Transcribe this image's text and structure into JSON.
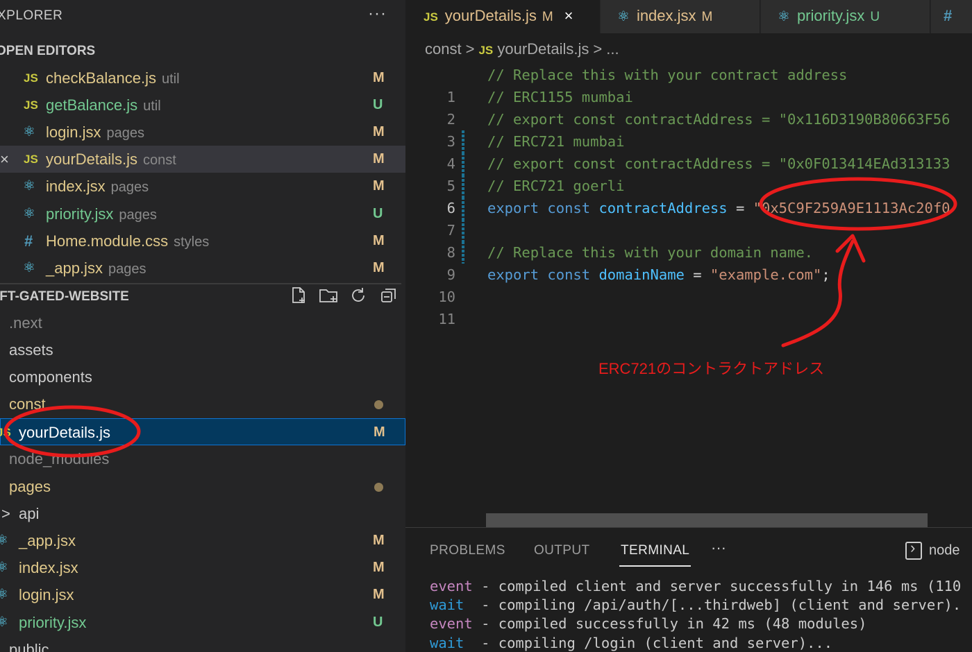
{
  "sidebar": {
    "title": "XPLORER",
    "more": "···",
    "open_editors_title": "OPEN EDITORS",
    "open_editors": [
      {
        "icon": "JS",
        "name": "checkBalance.js",
        "desc": "util",
        "status": "M"
      },
      {
        "icon": "JS",
        "name": "getBalance.js",
        "desc": "util",
        "status": "U"
      },
      {
        "icon": "react-icon",
        "name": "login.jsx",
        "desc": "pages",
        "status": "M"
      },
      {
        "icon": "JS",
        "name": "yourDetails.js",
        "desc": "const",
        "status": "M",
        "close": "×"
      },
      {
        "icon": "react-icon",
        "name": "index.jsx",
        "desc": "pages",
        "status": "M"
      },
      {
        "icon": "react-icon",
        "name": "priority.jsx",
        "desc": "pages",
        "status": "U"
      },
      {
        "icon": "#",
        "name": "Home.module.css",
        "desc": "styles",
        "status": "M"
      },
      {
        "icon": "react-icon",
        "name": "_app.jsx",
        "desc": "pages",
        "status": "M"
      }
    ],
    "project_title": "IFT-GATED-WEBSITE",
    "tree": [
      {
        "name": ".next"
      },
      {
        "name": "assets"
      },
      {
        "name": "components"
      },
      {
        "name": "const"
      },
      {
        "icon": "JS",
        "name": "yourDetails.js",
        "status": "M"
      },
      {
        "name": "node_modules"
      },
      {
        "name": "pages"
      },
      {
        "chevron": ">",
        "name": "api"
      },
      {
        "name": "_app.jsx",
        "status": "M"
      },
      {
        "name": "index.jsx",
        "status": "M"
      },
      {
        "name": "login.jsx",
        "status": "M"
      },
      {
        "name": "priority.jsx",
        "status": "U"
      },
      {
        "name": "public"
      }
    ]
  },
  "tabs": [
    {
      "icon": "JS",
      "name": "yourDetails.js",
      "status": "M",
      "close": "×"
    },
    {
      "icon": "react-icon",
      "name": "index.jsx",
      "status": "M"
    },
    {
      "icon": "react-icon",
      "name": "priority.jsx",
      "status": "U"
    },
    {
      "icon": "#",
      "name": ""
    }
  ],
  "breadcrumb": {
    "folder": "const",
    "sep": ">",
    "icon": "JS",
    "file": "yourDetails.js",
    "more": "..."
  },
  "code": {
    "line_numbers": [
      "1",
      "2",
      "3",
      "4",
      "5",
      "6",
      "7",
      "8",
      "9",
      "10",
      "11"
    ],
    "lines": [
      "// Replace this with your contract address",
      "// ERC1155 mumbai",
      "// export const contractAddress = \"0x116D3190B80663F56",
      "// ERC721 mumbai",
      "// export const contractAddress = \"0x0F013414EAd313133",
      "// ERC721 goerli",
      {
        "kw1": "export",
        "kw2": "const",
        "var": "contractAddress",
        "op": "=",
        "str": "\"0x5C9F259A9E1113Ac20f0"
      },
      "",
      "// Replace this with your domain name.",
      {
        "kw1": "export",
        "kw2": "const",
        "var": "domainName",
        "op": "=",
        "str": "\"example.com\"",
        "end": ";"
      },
      ""
    ]
  },
  "panel": {
    "tabs": [
      "PROBLEMS",
      "OUTPUT",
      "TERMINAL"
    ],
    "active_tab": "TERMINAL",
    "more": "···",
    "terminal_name": "node",
    "lines": [
      {
        "level": "event",
        "text": "- compiled client and server successfully in 146 ms (110"
      },
      {
        "level": "wait",
        "text": "- compiling /api/auth/[...thirdweb] (client and server)."
      },
      {
        "level": "event",
        "text": "- compiled successfully in 42 ms (48 modules)"
      },
      {
        "level": "wait",
        "text": "- compiling /login (client and server)..."
      }
    ]
  },
  "annotation": {
    "text": "ERC721のコントラクトアドレス",
    "color": "#e81c1c"
  }
}
